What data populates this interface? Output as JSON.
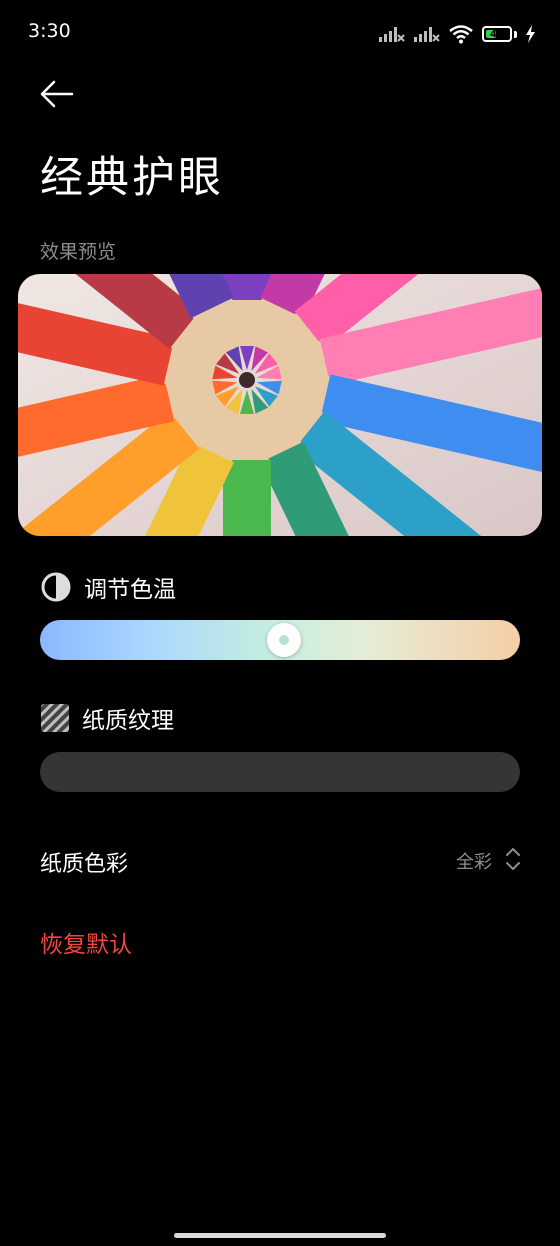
{
  "status_bar": {
    "time": "3:30",
    "battery_level": 47
  },
  "header": {
    "title": "经典护眼"
  },
  "preview": {
    "label": "效果预览"
  },
  "color_temperature": {
    "label": "调节色温",
    "value_fraction": 0.51
  },
  "paper_texture": {
    "label": "纸质纹理",
    "value_fraction": 0
  },
  "paper_color": {
    "label": "纸质色彩",
    "value": "全彩"
  },
  "reset": {
    "label": "恢复默认"
  },
  "colors": {
    "background": "#000000",
    "reset_red": "#ef4740",
    "secondary_text": "#8c8c8c"
  },
  "icons": [
    "back-arrow-icon",
    "contrast-icon",
    "texture-icon",
    "updown-icon"
  ]
}
